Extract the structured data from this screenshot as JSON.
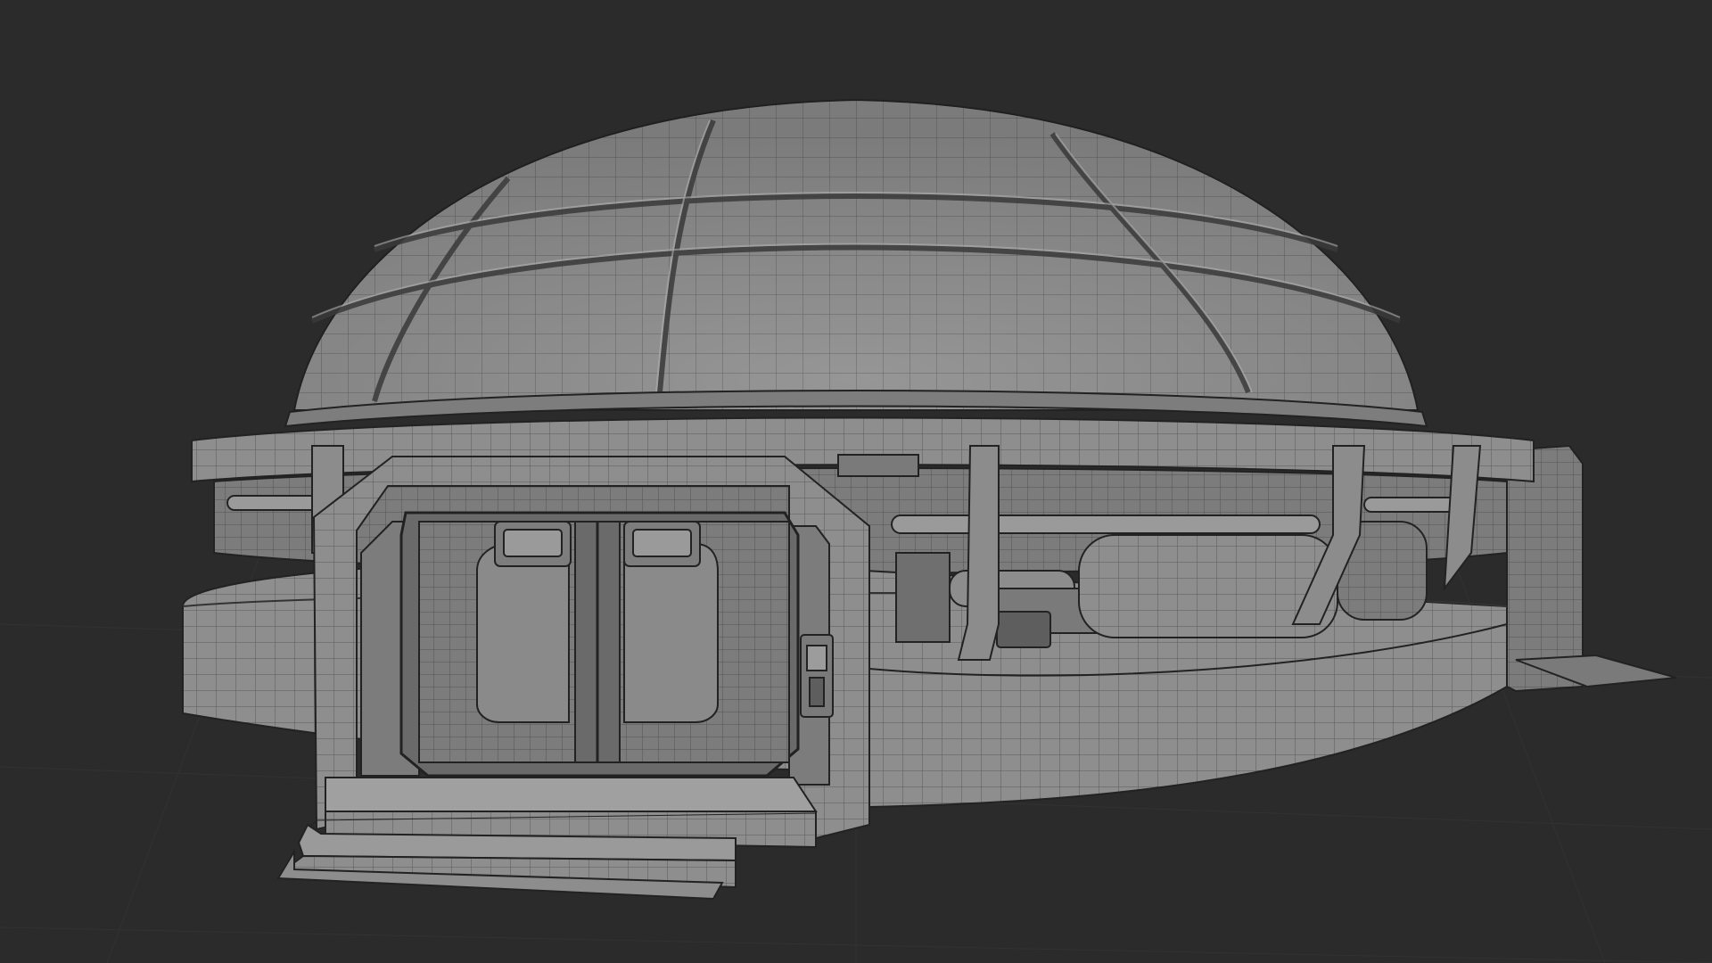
{
  "viewport": {
    "background": "#2b2b2b",
    "grid_color": "#343434",
    "mesh_fill": "#8a8a8a",
    "mesh_fill_light": "#9c9c9c",
    "mesh_fill_dark": "#6e6e6e",
    "wire_color": "#4a4a4a",
    "edge_color": "#1e1e1e",
    "shading": "solid-with-wireframe",
    "visible_objects": [
      "dome-roof",
      "base-ring",
      "entrance-door-frame",
      "double-door",
      "entrance-steps",
      "side-pipes",
      "side-module",
      "rear-box"
    ]
  }
}
